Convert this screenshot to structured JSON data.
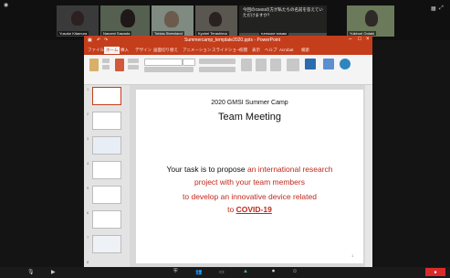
{
  "zoom": {
    "participants": [
      {
        "name": "Yusuke Kitamura"
      },
      {
        "name": "Nanami Sawada"
      },
      {
        "name": "Tobias Steenland"
      },
      {
        "name": "Kyohei Terashima"
      },
      {
        "name": "Kensuke Misaki"
      },
      {
        "name": "Yukinori Ootaki"
      }
    ],
    "chat_popup": "今回のGMSIの方が私たちの名前を答えていただけますか？"
  },
  "powerpoint": {
    "window_title": "Summercamp_template2020.pptx - PowerPoint",
    "tabs": [
      "ファイル",
      "ホーム",
      "挿入",
      "デザイン",
      "画面切り替え",
      "アニメーション",
      "スライドショー",
      "校閲",
      "表示",
      "ヘルプ",
      "Acrobat",
      "検索"
    ],
    "slide_numbers": [
      "1",
      "2",
      "3",
      "4",
      "5",
      "6",
      "7",
      "8"
    ],
    "slide": {
      "header": "2020 GMSI Summer Camp",
      "title": "Team Meeting",
      "line1_black": "Your task is to propose ",
      "line1_red": "an international research",
      "line2": "project with your team members",
      "line3": "to develop an innovative device related",
      "line4_prefix": "to ",
      "line4_emph": "COVID-19",
      "page_number": "1"
    },
    "colors": {
      "accent": "#c43e1c",
      "slide_red": "#c0281c"
    }
  }
}
